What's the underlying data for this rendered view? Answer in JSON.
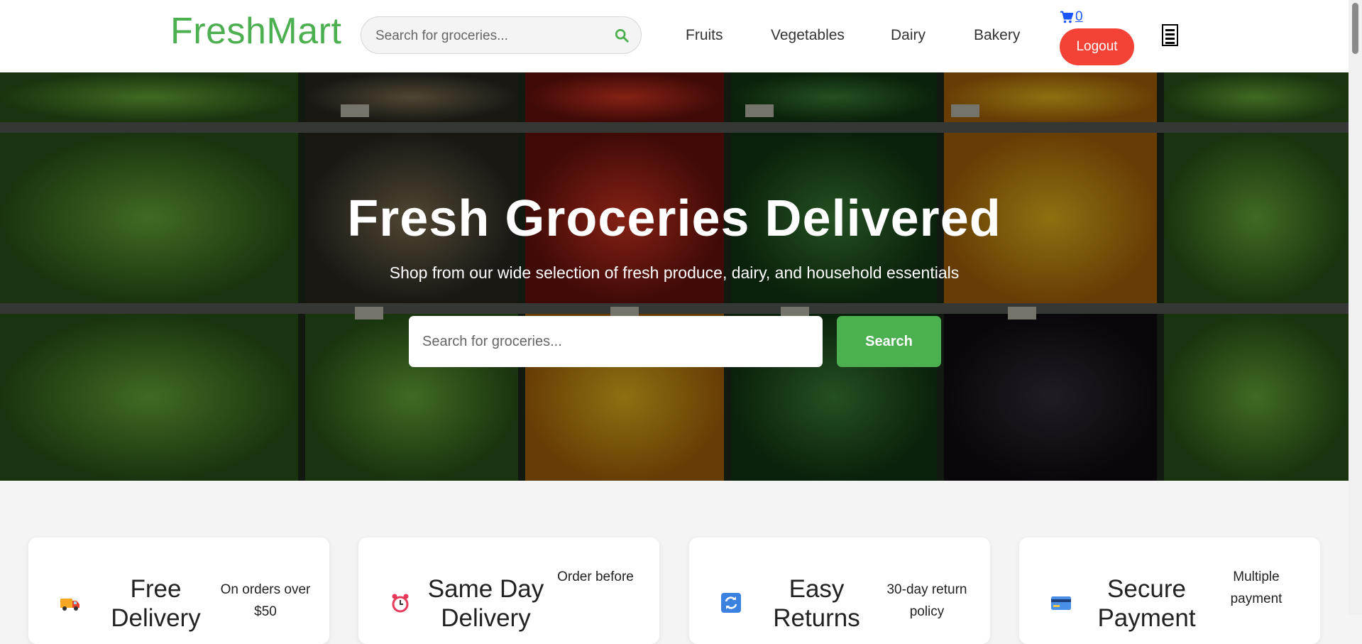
{
  "header": {
    "logo": "FreshMart",
    "search_placeholder": "Search for groceries...",
    "nav": [
      "Fruits",
      "Vegetables",
      "Dairy",
      "Bakery"
    ],
    "cart_count": "0",
    "logout_label": "Logout"
  },
  "hero": {
    "title": "Fresh Groceries Delivered",
    "subtitle": "Shop from our wide selection of fresh produce, dairy, and household essentials",
    "search_placeholder": "Search for groceries...",
    "search_button": "Search"
  },
  "features": [
    {
      "icon": "delivery-truck-icon",
      "title": "Free Delivery",
      "desc": "On orders over $50"
    },
    {
      "icon": "alarm-clock-icon",
      "title": "Same Day Delivery",
      "desc": "Order before"
    },
    {
      "icon": "refresh-icon",
      "title": "Easy Returns",
      "desc": "30-day return policy"
    },
    {
      "icon": "credit-card-icon",
      "title": "Secure Payment",
      "desc": "Multiple payment"
    }
  ],
  "colors": {
    "brand": "#4caf50",
    "logout": "#f44336",
    "cart_link": "#1a55ff"
  }
}
